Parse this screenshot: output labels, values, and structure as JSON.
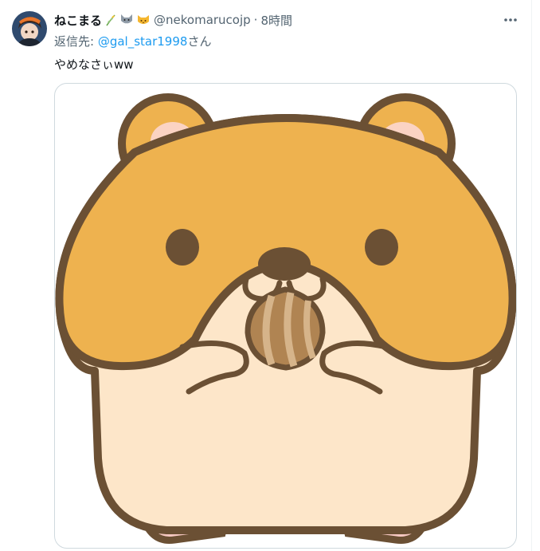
{
  "tweet": {
    "display_name": "ねこまる",
    "name_emojis": [
      "herb-icon",
      "wolf-face-icon",
      "cat-face-icon"
    ],
    "handle": "@nekomarucojp",
    "separator": "·",
    "timestamp": "8時間",
    "reply_prefix": "返信先: ",
    "reply_to": "@gal_star1998",
    "reply_suffix": "さん",
    "text": "やめなさぃww",
    "more_icon": "more-horizontal-icon",
    "media": {
      "description_icon": "hamster-eating-seed-image"
    }
  },
  "colors": {
    "text_primary": "#0f1419",
    "text_secondary": "#536471",
    "link": "#1d9bf0",
    "border": "#cfd9de",
    "hamster_orange": "#eeb24f",
    "hamster_cream": "#fde6c9",
    "outline": "#6b5034"
  }
}
